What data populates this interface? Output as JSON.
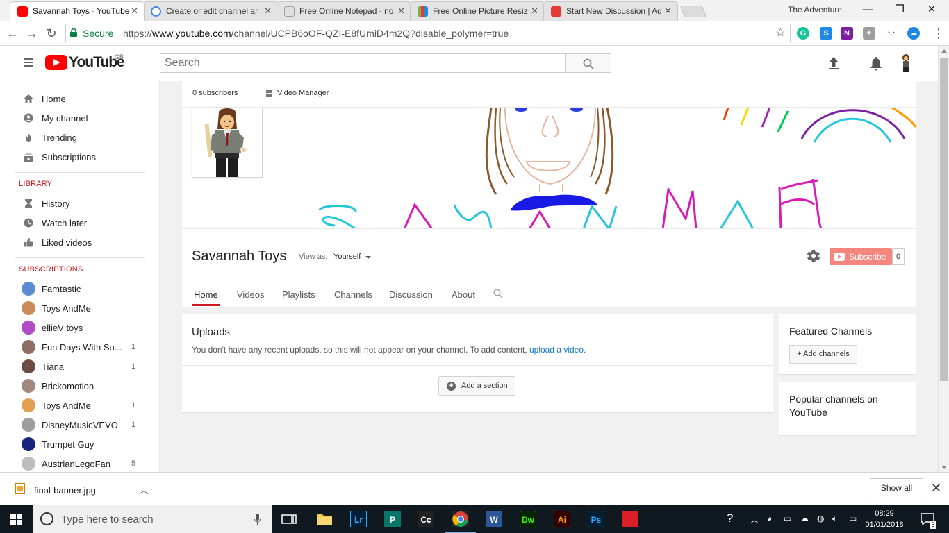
{
  "browser": {
    "tabs": [
      {
        "title": "Savannah Toys - YouTube",
        "active": true,
        "favicon_color": "#ff0000"
      },
      {
        "title": "Create or edit channel ar",
        "active": false,
        "favicon_color": "#4285f4"
      },
      {
        "title": "Free Online Notepad - no",
        "active": false,
        "favicon_color": "#9aa0a6"
      },
      {
        "title": "Free Online Picture Resiz",
        "active": false,
        "favicon_color": "#7cb342"
      },
      {
        "title": "Start New Discussion | Ad",
        "active": false,
        "favicon_color": "#e53935"
      }
    ],
    "window_title": "The Adventure...",
    "secure_label": "Secure",
    "url_scheme": "https://",
    "url_host": "www.youtube.com",
    "url_path": "/channel/UCPB6oOF-QZI-E8fUmiD4m2Q?disable_polymer=true"
  },
  "masthead": {
    "logo_text": "YouTube",
    "region": "GB",
    "search_placeholder": "Search"
  },
  "sidebar": {
    "main": [
      {
        "label": "Home",
        "icon": "home-icon"
      },
      {
        "label": "My channel",
        "icon": "account-icon"
      },
      {
        "label": "Trending",
        "icon": "flame-icon"
      },
      {
        "label": "Subscriptions",
        "icon": "subscriptions-icon"
      }
    ],
    "library_heading": "LIBRARY",
    "library": [
      {
        "label": "History",
        "icon": "hourglass-icon"
      },
      {
        "label": "Watch later",
        "icon": "clock-icon"
      },
      {
        "label": "Liked videos",
        "icon": "thumbs-up-icon"
      }
    ],
    "subscriptions_heading": "SUBSCRIPTIONS",
    "subscriptions": [
      {
        "label": "Famtastic",
        "count": "",
        "color": "#5b8bd0"
      },
      {
        "label": "Toys AndMe",
        "count": "",
        "color": "#c98b5a"
      },
      {
        "label": "ellieV toys",
        "count": "",
        "color": "#b14cc4"
      },
      {
        "label": "Fun Days With Su...",
        "count": "1",
        "color": "#8d6e63"
      },
      {
        "label": "Tiana",
        "count": "1",
        "color": "#6d4c41"
      },
      {
        "label": "Brickomotion",
        "count": "",
        "color": "#a1887f"
      },
      {
        "label": "Toys AndMe",
        "count": "1",
        "color": "#e0a050"
      },
      {
        "label": "DisneyMusicVEVO",
        "count": "1",
        "color": "#9e9e9e"
      },
      {
        "label": "Trumpet Guy",
        "count": "",
        "color": "#1a237e"
      },
      {
        "label": "AustrianLegoFan",
        "count": "5",
        "color": "#bdbdbd"
      }
    ]
  },
  "channel": {
    "subscribers": "0 subscribers",
    "video_manager": "Video Manager",
    "name": "Savannah Toys",
    "view_as_label": "View as:",
    "view_as_value": "Yourself",
    "subscribe_label": "Subscribe",
    "subscribe_count": "0",
    "tabs": [
      "Home",
      "Videos",
      "Playlists",
      "Channels",
      "Discussion",
      "About"
    ],
    "active_tab": "Home"
  },
  "uploads": {
    "title": "Uploads",
    "description": "You don't have any recent uploads, so this will not appear on your channel. To add content,",
    "link": "upload a video",
    "link_suffix": ".",
    "add_section": "Add a section"
  },
  "featured": {
    "title": "Featured Channels",
    "add_button": "+ Add channels"
  },
  "popular": {
    "title": "Popular channels on YouTube"
  },
  "downloads": {
    "file": "final-banner.jpg",
    "show_all": "Show all"
  },
  "taskbar": {
    "search_placeholder": "Type here to search",
    "time": "08:29",
    "date": "01/01/2018",
    "notification_count": "5",
    "apps": [
      {
        "label": "Lr",
        "name": "lightroom",
        "color": "#31a8ff",
        "bg": "#001e36"
      },
      {
        "label": "P",
        "name": "publisher",
        "color": "#ffffff",
        "bg": "#077568"
      },
      {
        "label": "Cc",
        "name": "app-red",
        "color": "#ffffff",
        "bg": "#222"
      },
      {
        "label": "",
        "name": "chrome",
        "color": "#fff",
        "bg": "#222"
      },
      {
        "label": "W",
        "name": "word",
        "color": "#ffffff",
        "bg": "#2b579a"
      },
      {
        "label": "Dw",
        "name": "dreamweaver",
        "color": "#35fa00",
        "bg": "#072401"
      },
      {
        "label": "Ai",
        "name": "illustrator",
        "color": "#ff9a00",
        "bg": "#330000"
      },
      {
        "label": "Ps",
        "name": "photoshop",
        "color": "#31a8ff",
        "bg": "#001e36"
      },
      {
        "label": "",
        "name": "creative-cloud",
        "color": "#fff",
        "bg": "#da1f26"
      }
    ]
  }
}
